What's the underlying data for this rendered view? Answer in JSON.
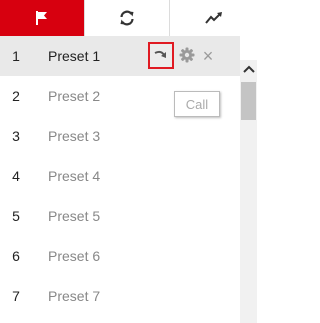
{
  "tabs": [
    {
      "icon": "flag-icon",
      "active": true
    },
    {
      "icon": "refresh-icon",
      "active": false
    },
    {
      "icon": "trend-icon",
      "active": false
    }
  ],
  "presets": [
    {
      "num": "1",
      "name": "Preset 1"
    },
    {
      "num": "2",
      "name": "Preset 2"
    },
    {
      "num": "3",
      "name": "Preset 3"
    },
    {
      "num": "4",
      "name": "Preset 4"
    },
    {
      "num": "5",
      "name": "Preset 5"
    },
    {
      "num": "6",
      "name": "Preset 6"
    },
    {
      "num": "7",
      "name": "Preset 7"
    }
  ],
  "actions": {
    "call_icon": "call-arrow-icon",
    "settings_icon": "gear-icon",
    "delete_icon": "close-icon",
    "delete_glyph": "×"
  },
  "tooltip": {
    "text": "Call"
  },
  "colors": {
    "active_tab": "#d7000f",
    "highlight_border": "#e01a22",
    "selected_row": "#e9e9e9"
  }
}
